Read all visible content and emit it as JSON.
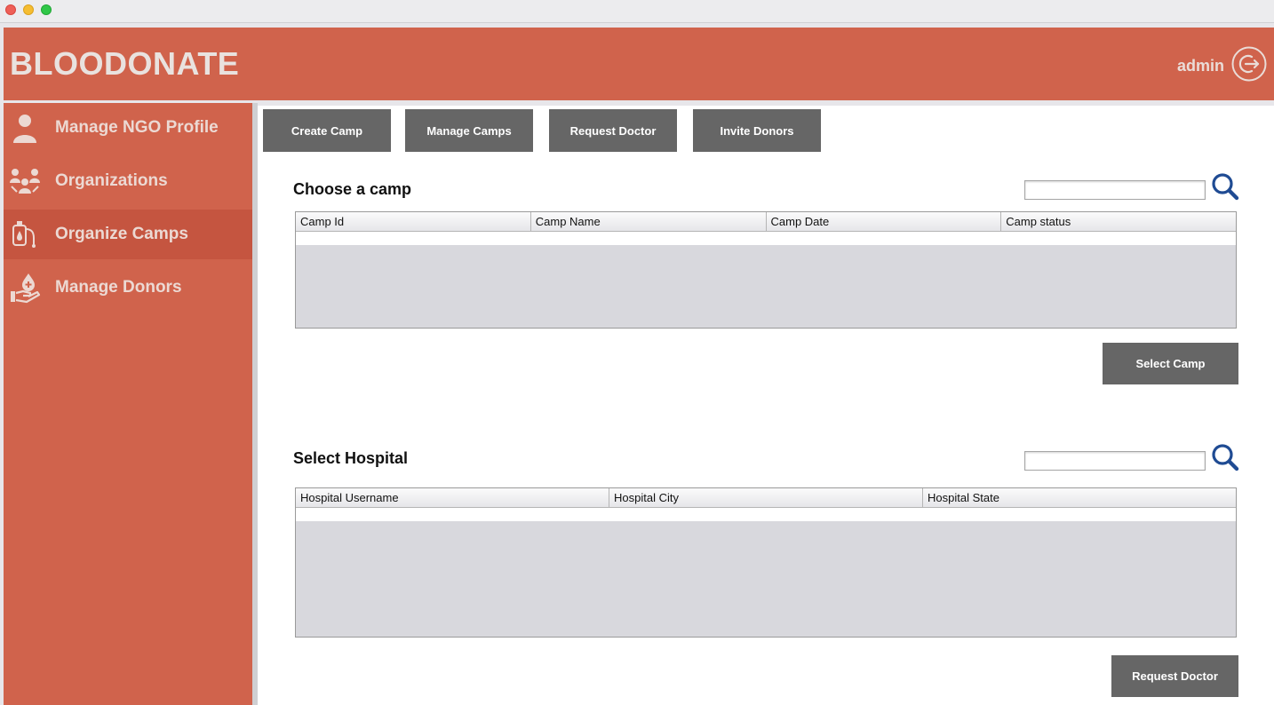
{
  "app": {
    "brand": "BLOODONATE",
    "user": "admin",
    "logout_icon": "logout-icon",
    "header_color": "#d0634c"
  },
  "sidebar": {
    "items": [
      {
        "label": "Manage NGO Profile",
        "icon": "user-profile-icon"
      },
      {
        "label": "Organizations",
        "icon": "organizations-icon"
      },
      {
        "label": "Organize Camps",
        "icon": "blood-bag-icon",
        "active": true
      },
      {
        "label": "Manage Donors",
        "icon": "donor-hand-icon"
      }
    ]
  },
  "tabs": [
    {
      "label": "Create Camp"
    },
    {
      "label": "Manage Camps"
    },
    {
      "label": "Request Doctor"
    },
    {
      "label": "Invite Donors"
    }
  ],
  "camp_section": {
    "title": "Choose a camp",
    "search_value": "",
    "search_icon": "search-icon",
    "columns": [
      "Camp Id",
      "Camp Name",
      "Camp Date",
      "Camp status"
    ],
    "rows": [],
    "action_label": "Select Camp"
  },
  "hospital_section": {
    "title": "Select Hospital",
    "search_value": "",
    "search_icon": "search-icon",
    "columns": [
      "Hospital Username",
      "Hospital City",
      "Hospital State"
    ],
    "rows": [],
    "action_label": "Request Doctor"
  }
}
